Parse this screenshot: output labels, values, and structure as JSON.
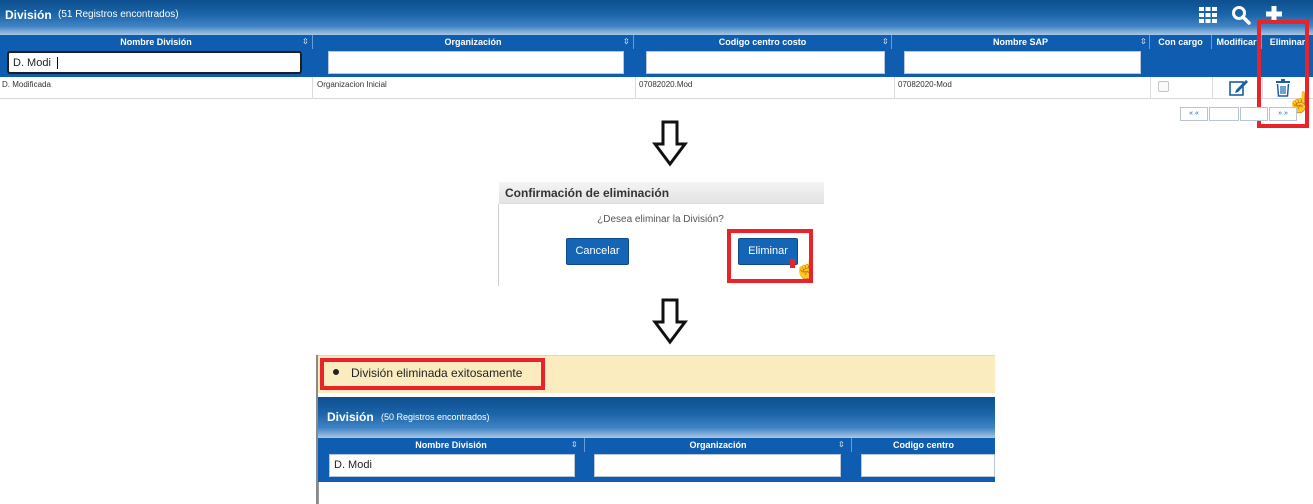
{
  "top_grid": {
    "title": "División",
    "count": "(51 Registros encontrados)",
    "icons": [
      "grid-icon",
      "search-icon",
      "plus-icon"
    ],
    "columns": [
      "Nombre División",
      "Organización",
      "Codigo centro costo",
      "Nombre SAP",
      "Con cargo",
      "Modificar",
      "Eliminar"
    ],
    "filters": {
      "nombre_division": "D. Modi",
      "organizacion": "",
      "codigo_centro_costo": "",
      "nombre_sap": ""
    },
    "rows": [
      {
        "nombre_division": "D. Modificada",
        "organizacion": "Organizacion Inicial",
        "codigo_centro_costo": "07082020.Mod",
        "nombre_sap": "07082020-Mod"
      }
    ],
    "pager": {
      "first": "«  «",
      "last": "»  »"
    }
  },
  "dialog": {
    "title": "Confirmación de eliminación",
    "message": "¿Desea eliminar la División?",
    "cancel_label": "Cancelar",
    "confirm_label": "Eliminar"
  },
  "success": {
    "message": "División eliminada exitosamente"
  },
  "bottom_grid": {
    "title": "División",
    "count": "(50 Registros encontrados)",
    "columns": [
      "Nombre División",
      "Organización",
      "Codigo centro"
    ],
    "filters": {
      "nombre_division": "D. Modi"
    }
  },
  "colors": {
    "header_blue": "#0f5db0",
    "highlight_red": "#e8232a",
    "button_blue": "#1565b6",
    "success_bg": "#fbecc0"
  }
}
